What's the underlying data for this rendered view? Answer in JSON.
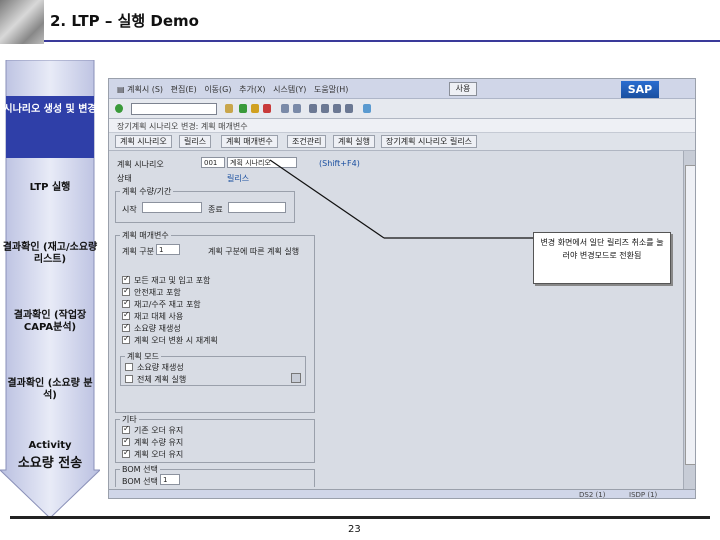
{
  "slide": {
    "title": "2. LTP – 실행 Demo",
    "page_number": "23",
    "accent_color": "#3a3a9a"
  },
  "sidebar": {
    "steps": [
      {
        "label": "시나리오 생성 및 변경",
        "active": true
      },
      {
        "label": "LTP 실행",
        "active": false
      },
      {
        "label": "결과확인 (재고/소요량 리스트)",
        "active": false
      },
      {
        "label": "결과확인 (작업장 CAPA분석)",
        "active": false
      },
      {
        "label": "결과확인 (소요량 분석)",
        "active": false
      },
      {
        "label": "Activity",
        "active": false
      },
      {
        "label": "소요량 전송",
        "active": false
      }
    ],
    "active_color": "#2f3fa8",
    "inactive_color": "#cfd3e8"
  },
  "sap": {
    "brand": "SAP",
    "menu_button": "사용",
    "app_title": "장기계획 시나리오 변경: 계획 매개변수",
    "tab_buttons": [
      "계획 시나리오",
      "릴리스",
      "계획 매개변수",
      "조건관리",
      "계획 실행",
      "장기계획 시나리오 릴리스"
    ],
    "fields": {
      "scenario_label": "계획 시나리오",
      "scenario_value": "001",
      "scenario_desc": "계획 시나리오",
      "status_label": "상태",
      "shortcut_hint": "(Shift+F4)",
      "dropdown_hint": "릴리스"
    },
    "groups": {
      "period": {
        "title": "계획 수량/기간",
        "start_label": "시작",
        "end_label": "종료"
      },
      "params": {
        "title": "계획 매개변수",
        "row_label": "계획 구분",
        "row_value": "1",
        "row_hint": "계획 구분에 따른 계획 실행"
      },
      "options": [
        {
          "label": "모든 재고 및 입고 포함",
          "checked": true
        },
        {
          "label": "안전재고 포함",
          "checked": true
        },
        {
          "label": "재고/수주 재고 포함",
          "checked": true
        },
        {
          "label": "재고 대체 사용",
          "checked": true
        },
        {
          "label": "소요량 재생성",
          "checked": true
        },
        {
          "label": "계획 오더 변환 시 재계획",
          "checked": true
        }
      ],
      "mode": {
        "title": "계획 모드",
        "items": [
          {
            "label": "소요량 재생성",
            "checked": false
          },
          {
            "label": "전체 계획 실행",
            "checked": false
          }
        ]
      },
      "other": {
        "title": "기타",
        "items": [
          {
            "label": "기존 오더 유지",
            "checked": true
          },
          {
            "label": "계획 수량 유지",
            "checked": true
          },
          {
            "label": "계획 오더 유지",
            "checked": true
          }
        ]
      },
      "bom": {
        "title": "BOM 선택",
        "row_label": "BOM 선택",
        "row_value": "1"
      }
    },
    "status": {
      "client": "DS2 (1)",
      "server": "ISDP (1)"
    }
  },
  "callout": {
    "text": "변경 화면에서 일단 릴리즈 취소를 눌러야 변경모드로 전환됨"
  }
}
